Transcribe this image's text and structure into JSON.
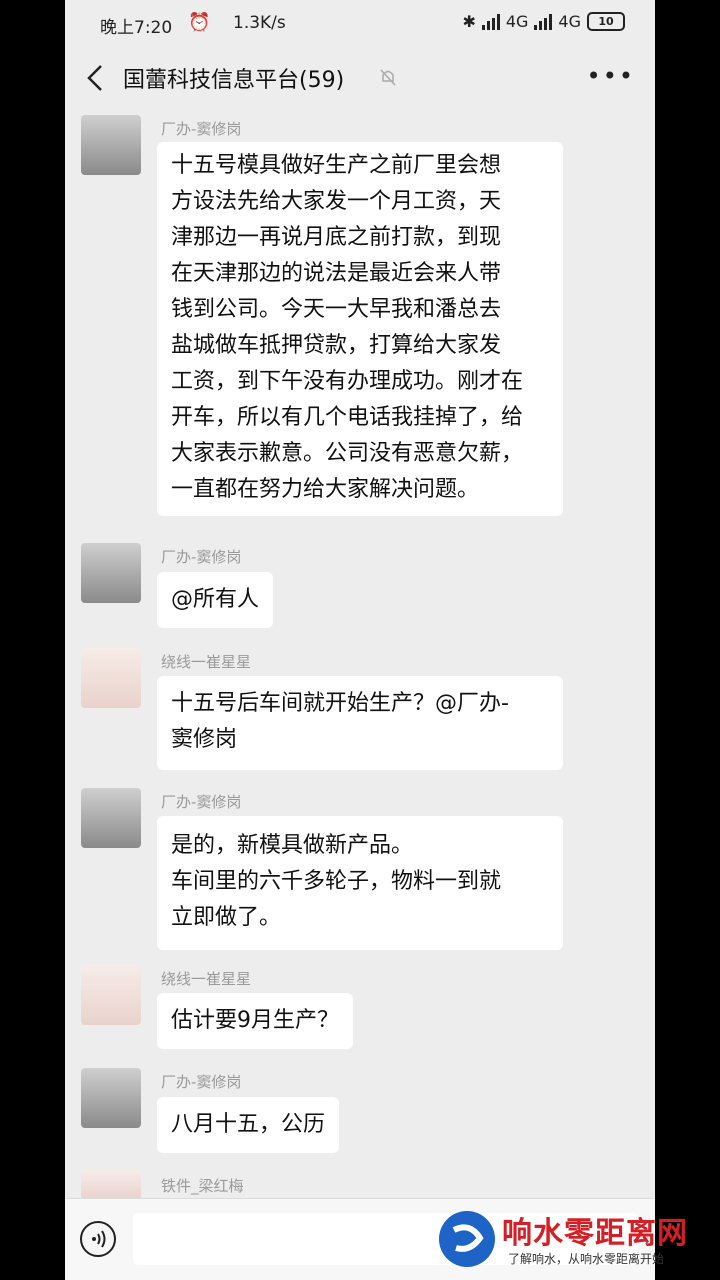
{
  "status": {
    "time": "晚上7:20",
    "speed": "1.3K/s",
    "net1": "4G",
    "net2": "4G",
    "battery": "10"
  },
  "header": {
    "title": "国蕾科技信息平台(59)"
  },
  "messages": [
    {
      "sender": "厂办-窦修岗",
      "text": "十五号模具做好生产之前厂里会想\n方设法先给大家发一个月工资，天\n津那边一再说月底之前打款，到现\n在天津那边的说法是最近会来人带\n钱到公司。今天一大早我和潘总去\n盐城做车抵押贷款，打算给大家发\n工资，到下午没有办理成功。刚才在\n开车，所以有几个电话我挂掉了，给\n大家表示歉意。公司没有恶意欠薪，\n一直都在努力给大家解决问题。"
    },
    {
      "sender": "厂办-窦修岗",
      "text": "@所有人"
    },
    {
      "sender": "绕线一崔星星",
      "text": "十五号后车间就开始生产？@厂办-\n窦修岗"
    },
    {
      "sender": "厂办-窦修岗",
      "text": "是的，新模具做新产品。\n车间里的六千多轮子，物料一到就\n立即做了。"
    },
    {
      "sender": "绕线一崔星星",
      "text": "估计要9月生产？"
    },
    {
      "sender": "厂办-窦修岗",
      "text": "八月十五，公历"
    },
    {
      "sender": "铁件_梁红梅",
      "text": ""
    }
  ],
  "watermark": {
    "title": "响水零距离网",
    "subtitle": "了解响水，从响水零距离开始"
  },
  "colors": {
    "accent": "#d41f26",
    "chat_bg": "#ededed",
    "bubble": "#ffffff"
  }
}
